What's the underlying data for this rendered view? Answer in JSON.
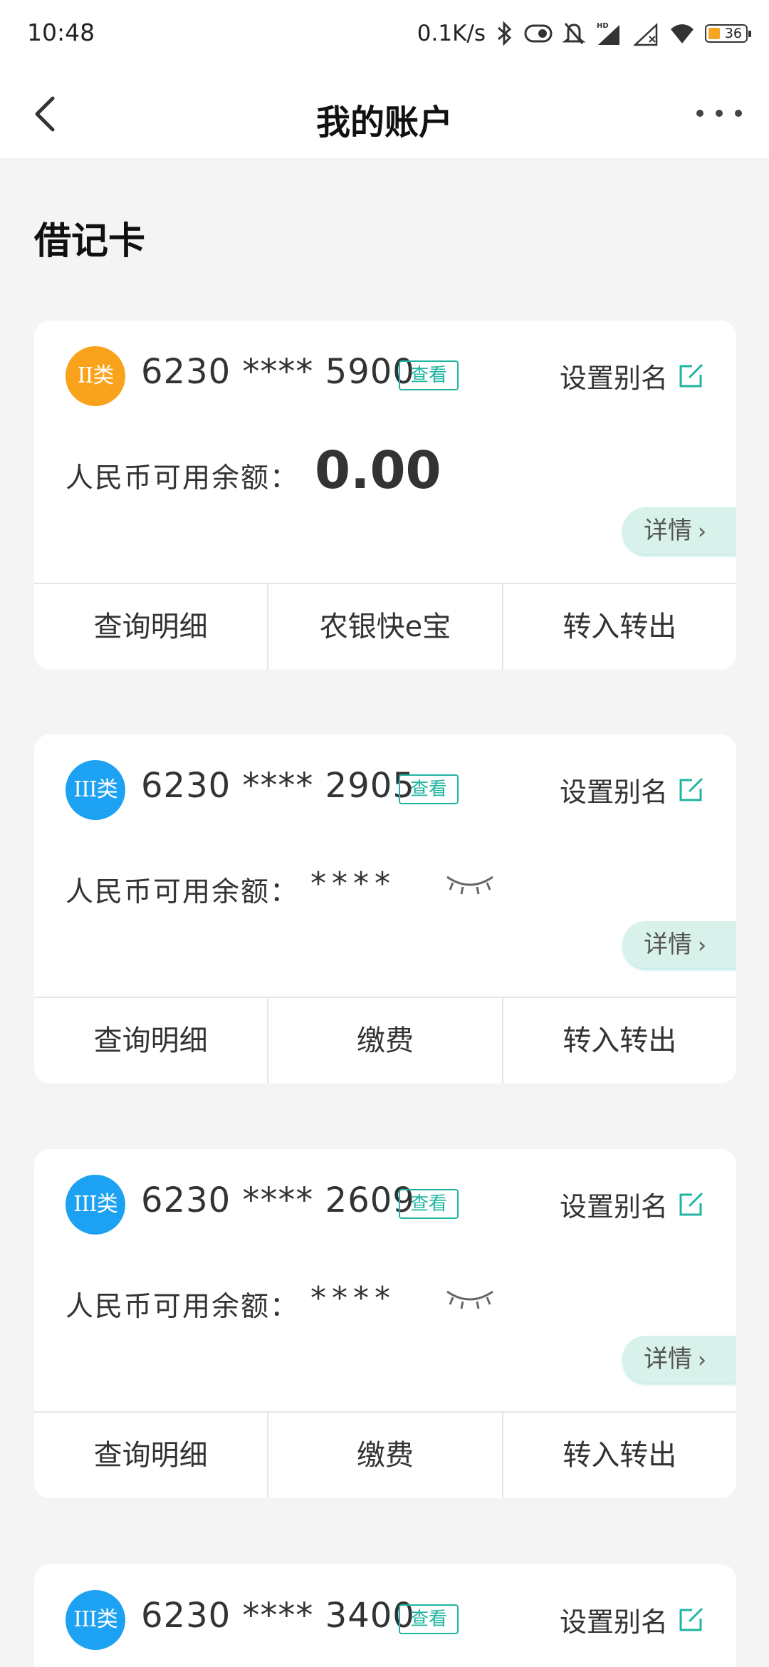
{
  "status_bar": {
    "time": "10:48",
    "net_speed": "0.1K/s",
    "battery": "36",
    "icons": [
      "bluetooth-icon",
      "toggle-icon",
      "mute-icon",
      "signal-hd-icon",
      "signal-empty-icon",
      "wifi-icon",
      "battery-icon"
    ]
  },
  "nav": {
    "title": "我的账户",
    "back_icon": "chevron-left-icon",
    "more_icon": "more-dots-icon"
  },
  "section_title": "借记卡",
  "accent_color": "#1fb5a0",
  "cards": [
    {
      "badge": "II类",
      "badge_color": "#f9a21b",
      "number": "6230 **** 5900",
      "view_label": "查看",
      "alias_label": "设置别名",
      "balance_label": "人民币可用余额：",
      "balance": "0.00",
      "detail_label": "详情",
      "actions": [
        "查询明细",
        "农银快e宝",
        "转入转出"
      ]
    },
    {
      "badge": "III类",
      "badge_color": "#1da1f2",
      "number": "6230 **** 2905",
      "view_label": "查看",
      "alias_label": "设置别名",
      "balance_label": "人民币可用余额：",
      "balance": "****",
      "detail_label": "详情",
      "actions": [
        "查询明细",
        "缴费",
        "转入转出"
      ]
    },
    {
      "badge": "III类",
      "badge_color": "#1da1f2",
      "number": "6230 **** 2609",
      "view_label": "查看",
      "alias_label": "设置别名",
      "balance_label": "人民币可用余额：",
      "balance": "****",
      "detail_label": "详情",
      "actions": [
        "查询明细",
        "缴费",
        "转入转出"
      ]
    },
    {
      "badge": "III类",
      "badge_color": "#1da1f2",
      "number": "6230 **** 3400",
      "view_label": "查看",
      "alias_label": "设置别名"
    }
  ]
}
